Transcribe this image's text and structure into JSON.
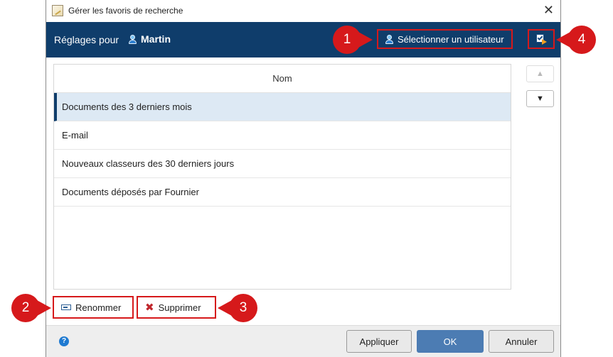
{
  "window": {
    "title": "Gérer les favoris de recherche",
    "close_icon": "close-icon"
  },
  "header": {
    "label": "Réglages pour",
    "user_name": "Martin",
    "select_user_label": "Sélectionner un utilisateur",
    "bg_color": "#0f3d6b"
  },
  "list": {
    "column_header": "Nom",
    "rows": [
      {
        "label": "Documents des 3 derniers mois",
        "selected": true
      },
      {
        "label": "E-mail",
        "selected": false
      },
      {
        "label": "Nouveaux classeurs des 30 derniers jours",
        "selected": false
      },
      {
        "label": "Documents déposés par Fournier",
        "selected": false
      }
    ]
  },
  "actions": {
    "rename_label": "Renommer",
    "delete_label": "Supprimer"
  },
  "footer": {
    "apply_label": "Appliquer",
    "ok_label": "OK",
    "cancel_label": "Annuler"
  },
  "callouts": [
    "1",
    "2",
    "3",
    "4"
  ],
  "colors": {
    "callout": "#d6191b",
    "accent": "#0f3d6b",
    "ok_button": "#4c7cb3",
    "selected_row": "#dde9f4"
  }
}
